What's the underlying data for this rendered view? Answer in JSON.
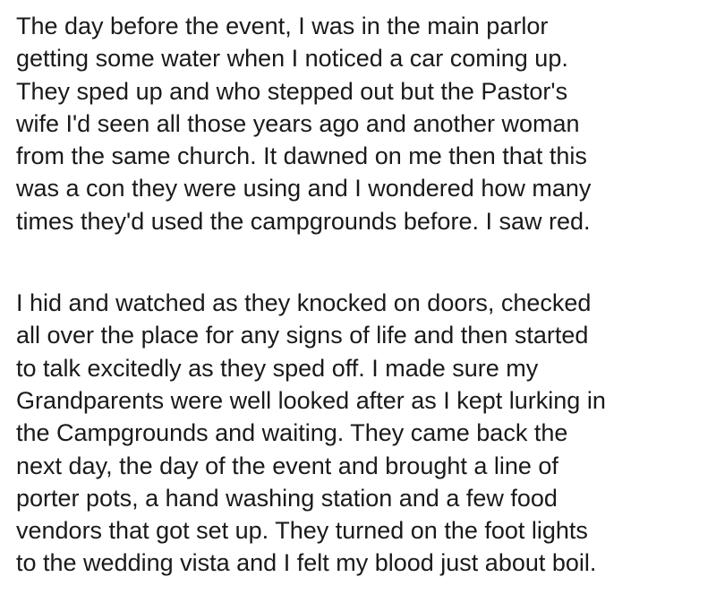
{
  "paragraphs": [
    {
      "lines": [
        "The day before the event, I was in the main parlor",
        "getting some water when I noticed a car coming up.",
        "They sped up and who stepped out but the Pastor's",
        "wife I'd seen all those years ago and another woman",
        "from the same church. It dawned on me then that this",
        "was a con they were using and I wondered how many",
        "times they'd used the campgrounds before. I saw red."
      ]
    },
    {
      "lines": [
        "I hid and watched as they knocked on doors, checked",
        "all over the place for any signs of life and then started",
        "to talk excitedly as they sped off. I made sure my",
        "Grandparents were well looked after as I kept lurking in",
        "the Campgrounds and waiting. They came back the",
        "next day, the day of the event and brought a line of",
        "porter pots, a hand washing station and a few food",
        "vendors that got set up. They turned on the foot lights",
        "to the wedding vista and I felt my blood just about boil."
      ]
    }
  ]
}
